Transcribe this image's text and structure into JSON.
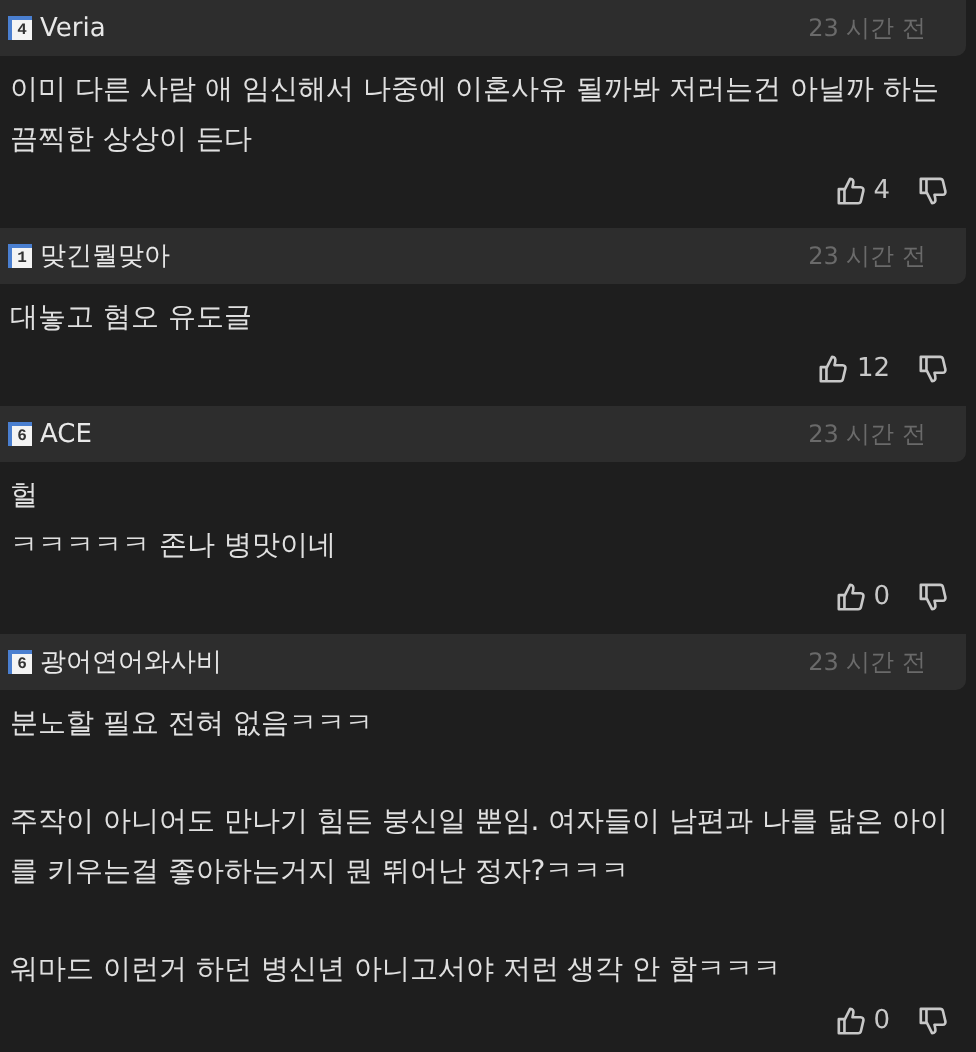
{
  "comments": [
    {
      "level": "4",
      "author": "Veria",
      "time": "23 시간 전",
      "paragraphs": [
        "이미 다른 사람 애 임신해서 나중에 이혼사유 될까봐 저러는건 아닐까 하는 끔찍한 상상이 든다"
      ],
      "likes": "4"
    },
    {
      "level": "1",
      "author": "맞긴뭘맞아",
      "time": "23 시간 전",
      "paragraphs": [
        "대놓고 혐오 유도글"
      ],
      "likes": "12"
    },
    {
      "level": "6",
      "author": "ACE",
      "time": "23 시간 전",
      "paragraphs": [
        "헐\nㅋㅋㅋㅋㅋ 존나 병맛이네"
      ],
      "likes": "0"
    },
    {
      "level": "6",
      "author": "광어연어와사비",
      "time": "23 시간 전",
      "paragraphs": [
        "분노할 필요 전혀 없음ㅋㅋㅋ",
        "주작이 아니어도 만나기 힘든 붕신일 뿐임. 여자들이 남편과 나를 닮은 아이를 키우는걸 좋아하는거지 뭔 뛰어난 정자?ㅋㅋㅋ",
        "워마드 이런거 하던 병신년 아니고서야 저런 생각 안 함ㅋㅋㅋ"
      ],
      "likes": "0"
    }
  ]
}
